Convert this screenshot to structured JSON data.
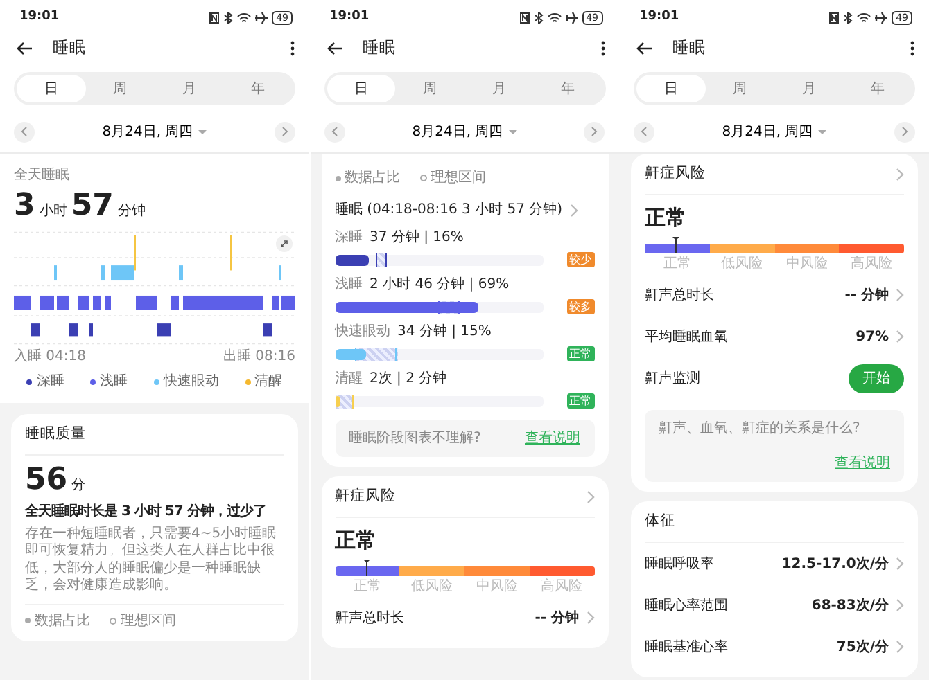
{
  "screens": [
    {
      "status_bar": {
        "time": "19:01",
        "battery": "49"
      },
      "header": {
        "title": "睡眠"
      },
      "tabs": [
        {
          "label": "日",
          "selected": true
        },
        {
          "label": "周",
          "selected": false
        },
        {
          "label": "月",
          "selected": false
        },
        {
          "label": "年",
          "selected": false
        }
      ],
      "date_nav": {
        "date": "8月24日, 周四"
      },
      "sections": [
        {
          "kind": "summary",
          "label": "全天睡眠",
          "hours": "3",
          "hours_unit": "小时",
          "minutes": "57",
          "minutes_unit": "分钟",
          "start_label": "入睡 04:18",
          "end_label": "出睡 08:16",
          "legend": [
            {
              "label": "深睡",
              "color": "#3b3fb3"
            },
            {
              "label": "浅睡",
              "color": "#5d5fe8"
            },
            {
              "label": "快速眼动",
              "color": "#6ec6f7"
            },
            {
              "label": "清醒",
              "color": "#f5b82e"
            }
          ]
        },
        {
          "kind": "quality",
          "title": "睡眠质量",
          "score": "56",
          "score_unit": "分",
          "headline": "全天睡眠时长是 3 小时 57 分钟，过少了",
          "body": "存在一种短睡眠者，只需要4~5小时睡眠即可恢复精力。但这类人在人群占比中很低，大部分人的睡眠偏少是一种睡眠缺乏，会对健康造成影响。",
          "legend": [
            {
              "label": "数据占比",
              "kind": "filled"
            },
            {
              "label": "理想区间",
              "kind": "ring"
            }
          ]
        }
      ]
    },
    {
      "status_bar": {
        "time": "19:01",
        "battery": "49"
      },
      "header": {
        "title": "睡眠"
      },
      "tabs": [
        {
          "label": "日",
          "selected": true
        },
        {
          "label": "周",
          "selected": false
        },
        {
          "label": "月",
          "selected": false
        },
        {
          "label": "年",
          "selected": false
        }
      ],
      "date_nav": {
        "date": "8月24日, 周四"
      },
      "sections": [
        {
          "kind": "stages",
          "legend": [
            {
              "label": "数据占比",
              "kind": "filled"
            },
            {
              "label": "理想区间",
              "kind": "ring"
            }
          ],
          "title": "睡眠 (04:18-08:16  3 小时 57 分钟)",
          "stages": [
            {
              "name": "深睡",
              "value": "37 分钟 | 16%",
              "color": "#3b3fb3",
              "level": 0.16,
              "ideal_from": {
                "level": 0.2
              },
              "ideal_to": {
                "level": 0.25
              },
              "badge": {
                "label": "较少",
                "color": "#f08a2c"
              }
            },
            {
              "name": "浅睡",
              "value": "2 小时 46 分钟 | 69%",
              "color": "#5d5fe8",
              "level": 0.69,
              "ideal_from": {
                "level": 0.5
              },
              "ideal_to": {
                "level": 0.6
              },
              "badge": {
                "label": "较多",
                "color": "#f08a2c"
              }
            },
            {
              "name": "快速眼动",
              "value": "34 分钟 | 15%",
              "color": "#6ec6f7",
              "level": 0.15,
              "ideal_from": {
                "level": 0.1
              },
              "ideal_to": {
                "level": 0.3
              },
              "badge": {
                "label": "正常",
                "color": "#2fb35a"
              }
            },
            {
              "name": "清醒",
              "value": "2次 | 2 分钟",
              "color": "#f7cf4f",
              "level": 0.02,
              "ideal_from": {
                "level": 0.0
              },
              "ideal_to": {
                "level": 0.09
              },
              "badge": {
                "label": "正常",
                "color": "#2fb35a"
              }
            }
          ],
          "help": {
            "kind": "inline",
            "text": "睡眠阶段图表不理解?",
            "link": "查看说明"
          }
        },
        {
          "kind": "snore",
          "title": "鼾症风险",
          "value": "正常",
          "scale": [
            "正常",
            "低风险",
            "中风险",
            "高风险"
          ],
          "level": 0.12,
          "rows": [
            {
              "kind": "value",
              "label": "鼾声总时长",
              "value": "-- 分钟"
            }
          ]
        }
      ]
    },
    {
      "status_bar": {
        "time": "19:01",
        "battery": "49"
      },
      "header": {
        "title": "睡眠"
      },
      "tabs": [
        {
          "label": "日",
          "selected": true
        },
        {
          "label": "周",
          "selected": false
        },
        {
          "label": "月",
          "selected": false
        },
        {
          "label": "年",
          "selected": false
        }
      ],
      "date_nav": {
        "date": "8月24日, 周四"
      },
      "sections": [
        {
          "kind": "snore",
          "title": "鼾症风险",
          "value": "正常",
          "scale": [
            "正常",
            "低风险",
            "中风险",
            "高风险"
          ],
          "level": 0.12,
          "rows": [
            {
              "kind": "value",
              "label": "鼾声总时长",
              "value": "-- 分钟"
            },
            {
              "kind": "value",
              "label": "平均睡眠血氧",
              "value": "97%"
            },
            {
              "kind": "button",
              "label": "鼾声监测",
              "button": "开始"
            }
          ],
          "help": {
            "kind": "stacked",
            "text": "鼾声、血氧、鼾症的关系是什么?",
            "link": "查看说明"
          }
        },
        {
          "kind": "vitals",
          "title": "体征",
          "rows": [
            {
              "kind": "value",
              "label": "睡眠呼吸率",
              "value": "12.5-17.0次/分"
            },
            {
              "kind": "value",
              "label": "睡眠心率范围",
              "value": "68-83次/分"
            },
            {
              "kind": "value",
              "label": "睡眠基准心率",
              "value": "75次/分"
            }
          ]
        }
      ]
    }
  ]
}
